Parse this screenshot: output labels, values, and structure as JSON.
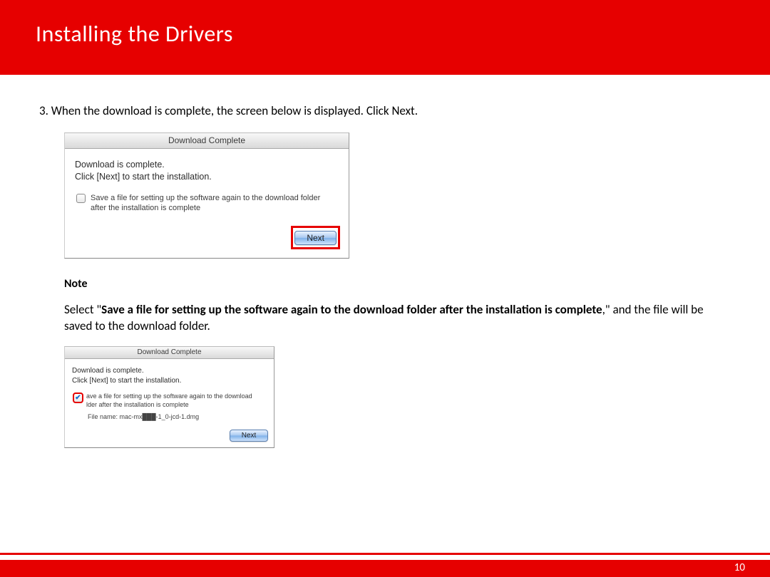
{
  "header": {
    "title": "Installing  the Drivers"
  },
  "step": {
    "number": "3.",
    "text": "When the download is complete, the screen below is displayed. Click Next."
  },
  "dialog1": {
    "title": "Download Complete",
    "line1": "Download is complete.",
    "line2": "Click [Next] to start the installation.",
    "checkbox_label": "Save a file for setting up the software again to the download folder after the installation is complete",
    "next_button": "Next"
  },
  "note": {
    "heading": "Note",
    "prefix": "Select \"",
    "bold": "Save a file for setting up the software again to the download folder after the installation is complete",
    "suffix": ",\" and the file will be saved to the download folder."
  },
  "dialog2": {
    "title": "Download Complete",
    "line1": "Download is complete.",
    "line2": "Click [Next] to start the installation.",
    "checkbox_label_a": "ave a file for setting up the software again to the download",
    "checkbox_label_b": "lder after the installation is complete",
    "filename_label": "File name:  mac-mx███-1_0-jcd-1.dmg",
    "next_button": "Next"
  },
  "page_number": "10"
}
